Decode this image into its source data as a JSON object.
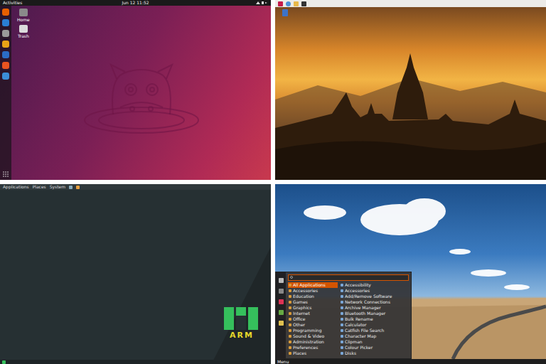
{
  "screens": [
    {
      "kind": "ubuntu",
      "top_bar": {
        "activities": "Activities",
        "clock": "Jun 12 11:52"
      },
      "desktop_icons": [
        {
          "label": "Home"
        },
        {
          "label": "Trash"
        }
      ]
    },
    {
      "kind": "raspberry-pi"
    },
    {
      "kind": "manjaro-arm",
      "panel_menus": [
        "Applications",
        "Places",
        "System"
      ],
      "logo": {
        "text": "ARM"
      }
    },
    {
      "kind": "xfce",
      "menu": {
        "categories": [
          {
            "label": "All Applications",
            "selected": true
          },
          {
            "label": "Accessories",
            "selected": false
          },
          {
            "label": "Education",
            "selected": false
          },
          {
            "label": "Games",
            "selected": false
          },
          {
            "label": "Graphics",
            "selected": false
          },
          {
            "label": "Internet",
            "selected": false
          },
          {
            "label": "Office",
            "selected": false
          },
          {
            "label": "Other",
            "selected": false
          },
          {
            "label": "Programming",
            "selected": false
          },
          {
            "label": "Sound & Video",
            "selected": false
          },
          {
            "label": "Administration",
            "selected": false
          },
          {
            "label": "Preferences",
            "selected": false
          },
          {
            "label": "Places",
            "selected": false
          }
        ],
        "apps": [
          "Accessibility",
          "Accessories",
          "Add/Remove Software",
          "Network Connections",
          "Archive Manager",
          "Bluetooth Manager",
          "Bulk Rename",
          "Calculator",
          "Catfish File Search",
          "Character Map",
          "Clipman",
          "Colour Picker",
          "Disks"
        ]
      },
      "panel": {
        "start": "Menu"
      }
    }
  ]
}
